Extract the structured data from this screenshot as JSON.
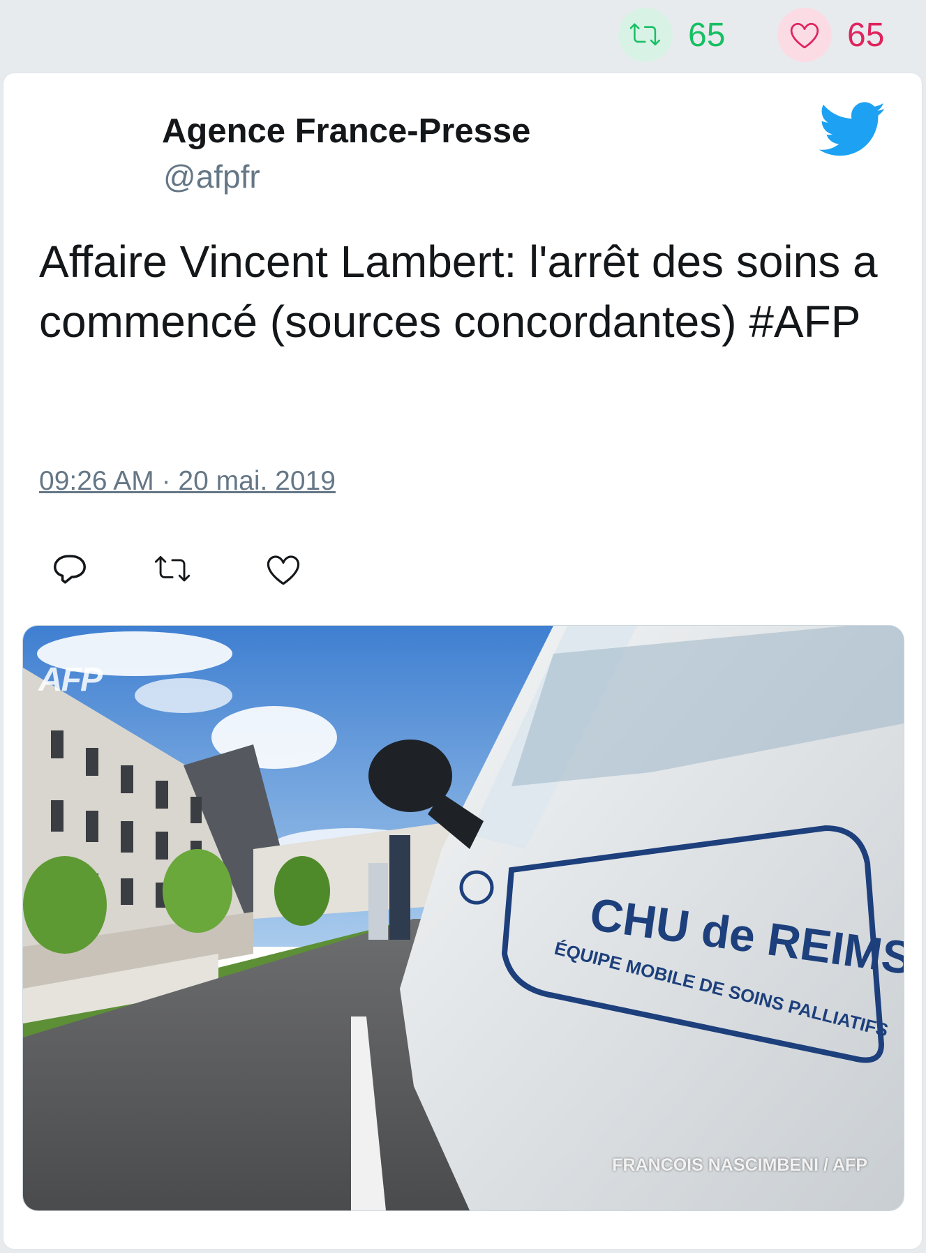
{
  "stats": {
    "retweets": "65",
    "likes": "65"
  },
  "tweet": {
    "author_name": "Agence France-Presse",
    "author_handle": "@afpfr",
    "text": "Affaire Vincent Lambert: l'arrêt des soins a commencé (sources concordantes) #AFP",
    "timestamp": "09:26 AM · 20 mai. 2019",
    "photo_credit": "FRANCOIS NASCIMBENI / AFP",
    "photo_watermark": "AFP",
    "photo_sign_line1": "CHU de REIMS",
    "photo_sign_line2": "ÉQUIPE MOBILE DE SOINS PALLIATIFS"
  },
  "icons": {
    "retweet": "retweet-icon",
    "like": "heart-icon",
    "reply": "reply-icon",
    "brand": "twitter-bird-icon"
  },
  "colors": {
    "retweet": "#17bf63",
    "like": "#e0245e",
    "brand": "#1da1f2",
    "secondary_text": "#657786"
  }
}
